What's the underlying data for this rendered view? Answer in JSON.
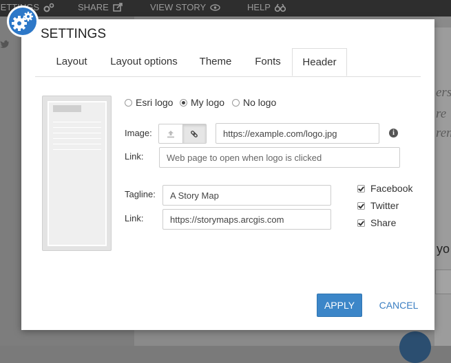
{
  "topbar": {
    "settings_label": "SETTINGS",
    "share_label": "SHARE",
    "view_story_label": "VIEW STORY",
    "help_label": "HELP"
  },
  "background": {
    "italic_lines": [
      "ers",
      "re",
      "ren"
    ],
    "partial_heading": "yo"
  },
  "modal": {
    "title": "SETTINGS",
    "tabs": [
      {
        "label": "Layout",
        "active": false
      },
      {
        "label": "Layout options",
        "active": false
      },
      {
        "label": "Theme",
        "active": false
      },
      {
        "label": "Fonts",
        "active": false
      },
      {
        "label": "Header",
        "active": true
      }
    ],
    "logo_options": [
      {
        "label": "Esri logo",
        "selected": false
      },
      {
        "label": "My logo",
        "selected": true
      },
      {
        "label": "No logo",
        "selected": false
      }
    ],
    "image_label": "Image:",
    "image_url_value": "https://example.com/logo.jpg",
    "link_label": "Link:",
    "logo_link_placeholder": "Web page to open when logo is clicked",
    "tagline_label": "Tagline:",
    "tagline_value": "A Story Map",
    "tagline_link_label": "Link:",
    "tagline_link_value": "https://storymaps.arcgis.com",
    "social": [
      {
        "label": "Facebook",
        "checked": true
      },
      {
        "label": "Twitter",
        "checked": true
      },
      {
        "label": "Share",
        "checked": true
      }
    ],
    "apply_label": "APPLY",
    "cancel_label": "CANCEL",
    "info_glyph": "i"
  },
  "colors": {
    "accent": "#3c86c8",
    "link": "#3a7ec2",
    "topbar": "#2e2e2e"
  },
  "icons": [
    "gears-icon",
    "share-icon",
    "eye-icon",
    "binoculars-icon",
    "upload-icon",
    "link-icon",
    "info-icon",
    "twitter-icon"
  ]
}
